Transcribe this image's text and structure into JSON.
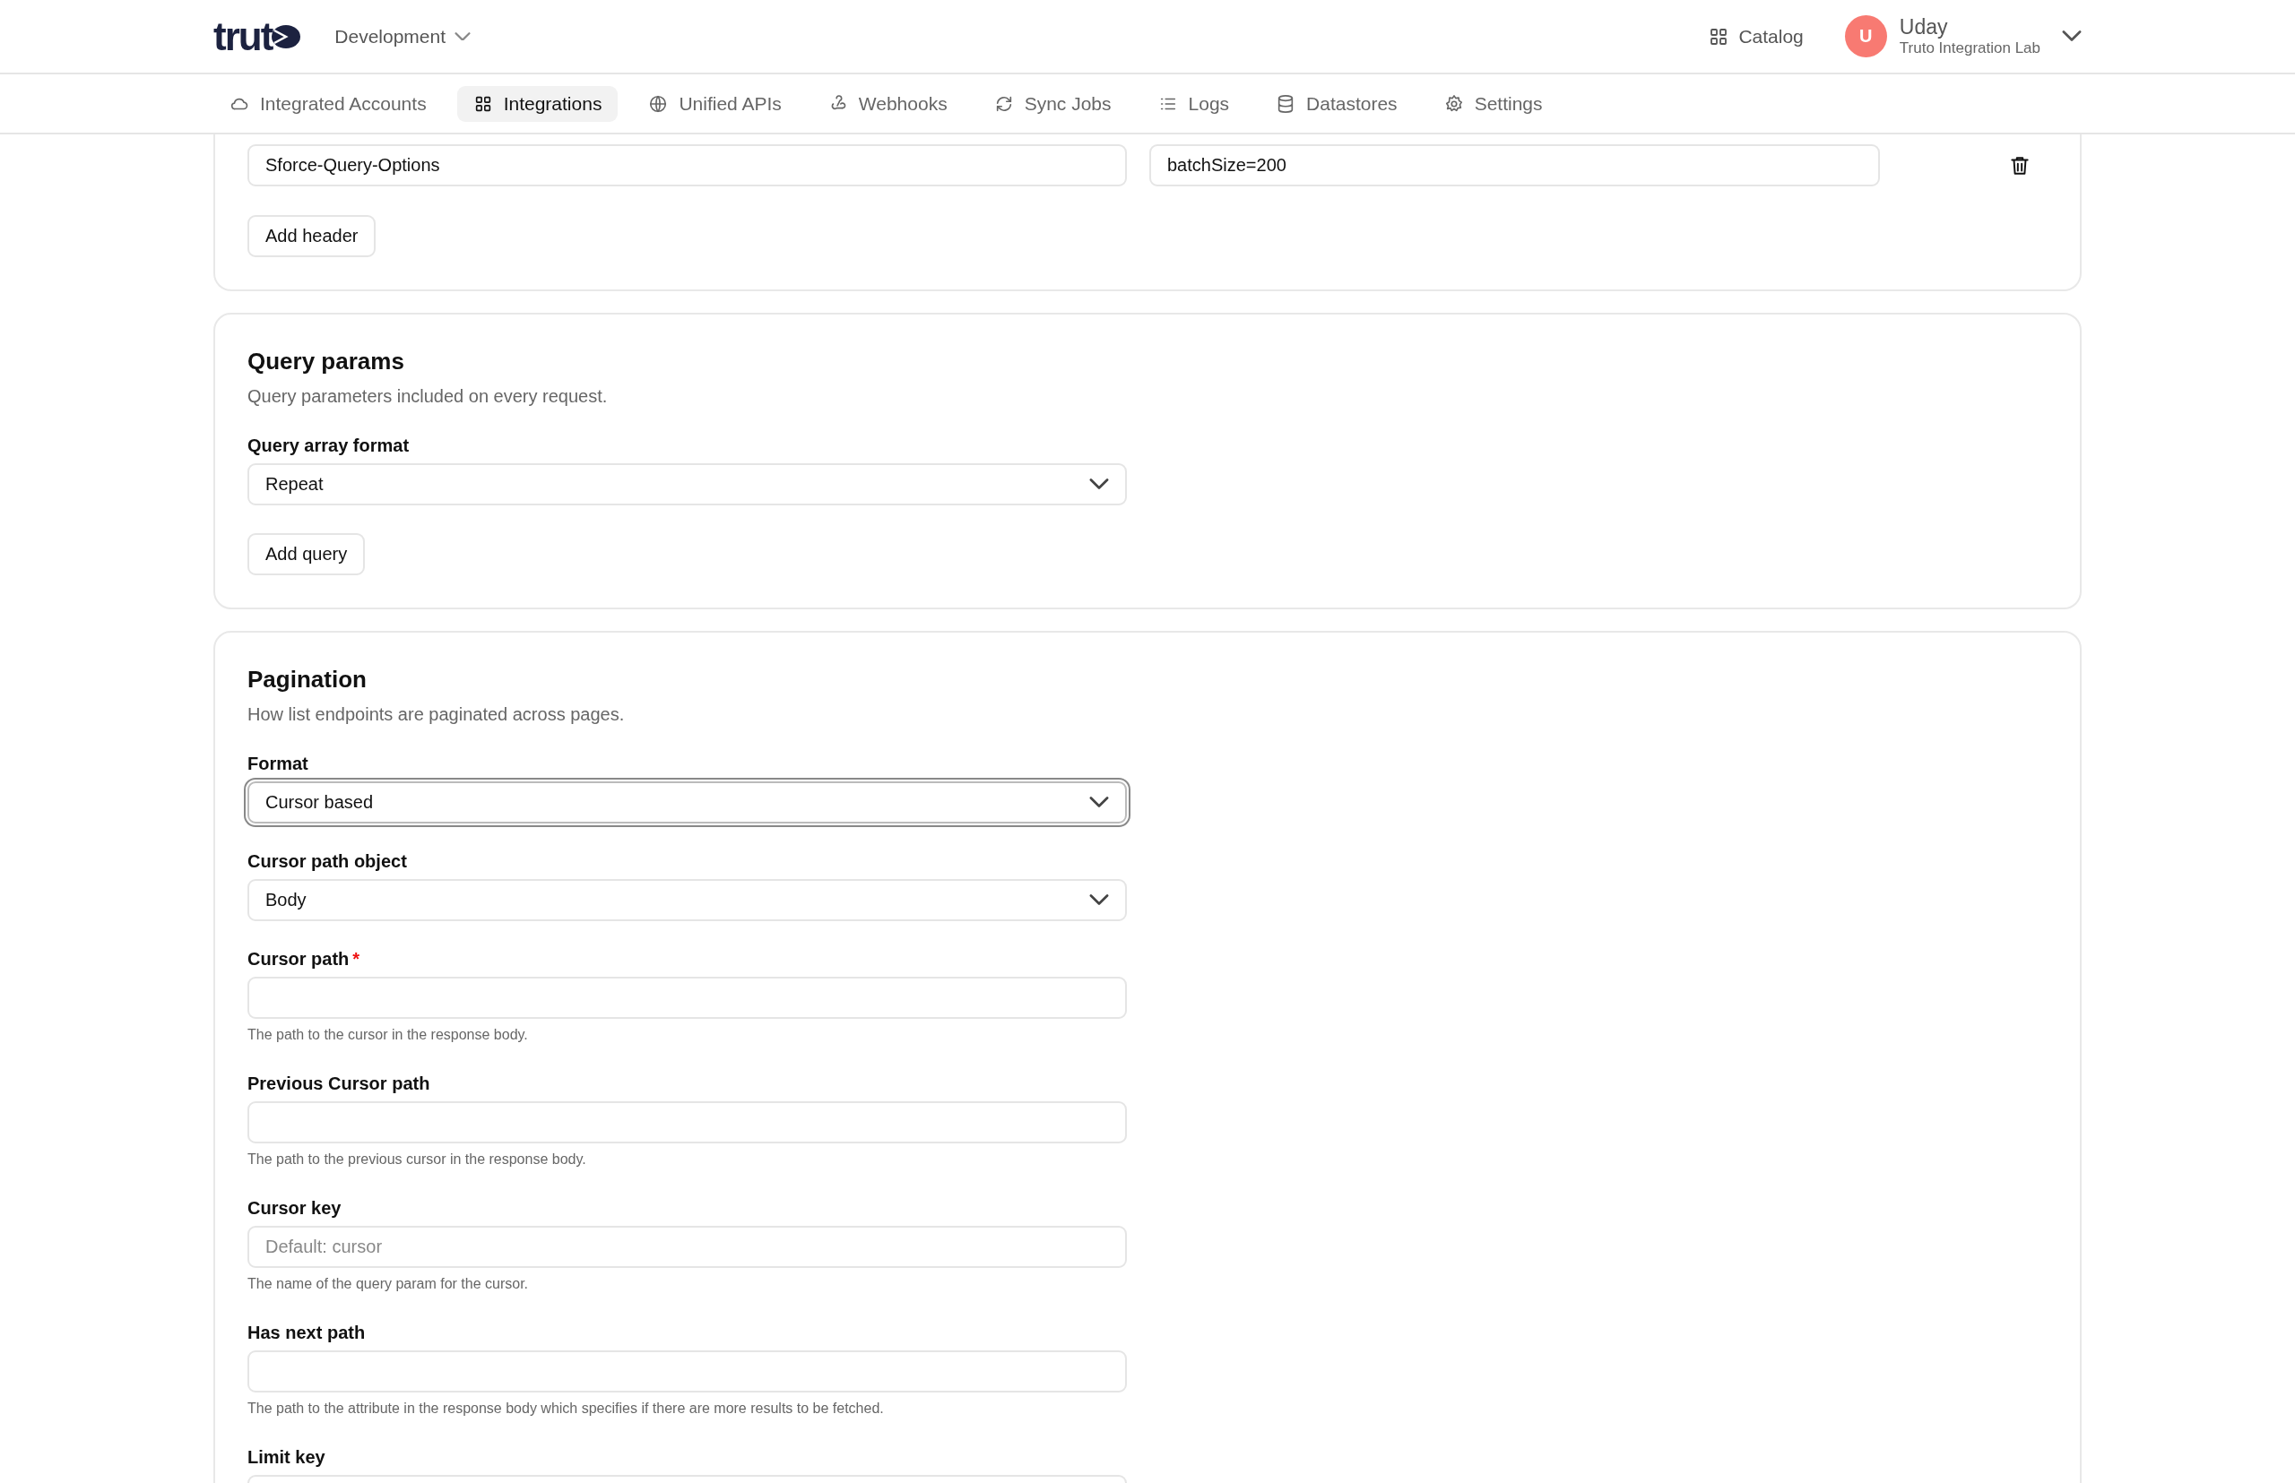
{
  "header": {
    "logo_text": "trut",
    "environment": "Development",
    "catalog": "Catalog",
    "user": {
      "initial": "U",
      "name": "Uday",
      "org": "Truto Integration Lab"
    }
  },
  "nav": {
    "tabs": [
      {
        "label": "Integrated Accounts",
        "selected": false
      },
      {
        "label": "Integrations",
        "selected": true
      },
      {
        "label": "Unified APIs",
        "selected": false
      },
      {
        "label": "Webhooks",
        "selected": false
      },
      {
        "label": "Sync Jobs",
        "selected": false
      },
      {
        "label": "Logs",
        "selected": false
      },
      {
        "label": "Datastores",
        "selected": false
      },
      {
        "label": "Settings",
        "selected": false
      }
    ]
  },
  "headers_card": {
    "rows": [
      {
        "key": "Sforce-Query-Options",
        "value": "batchSize=200"
      }
    ],
    "button": "Add header"
  },
  "query_card": {
    "title": "Query params",
    "description": "Query parameters included on every request.",
    "fields": [
      {
        "kind": "select",
        "label": "Query array format",
        "value": "Repeat",
        "focused": false
      }
    ],
    "button": "Add query"
  },
  "pagination_card": {
    "title": "Pagination",
    "description": "How list endpoints are paginated across pages.",
    "fields": [
      {
        "kind": "select",
        "label": "Format",
        "value": "Cursor based",
        "focused": true
      },
      {
        "kind": "select",
        "label": "Cursor path object",
        "value": "Body",
        "focused": false
      },
      {
        "kind": "input",
        "label": "Cursor path",
        "required_mark": "*",
        "focused": false,
        "helper": "The path to the cursor in the response body."
      },
      {
        "kind": "input",
        "label": "Previous Cursor path",
        "focused": false,
        "helper": "The path to the previous cursor in the response body."
      },
      {
        "kind": "input",
        "label": "Cursor key",
        "placeholder": "Default: cursor",
        "focused": false,
        "helper": "The name of the query param for the cursor."
      },
      {
        "kind": "input",
        "label": "Has next path",
        "focused": false,
        "helper": "The path to the attribute in the response body which specifies if there are more results to be fetched."
      },
      {
        "kind": "input",
        "label": "Limit key"
      }
    ]
  }
}
